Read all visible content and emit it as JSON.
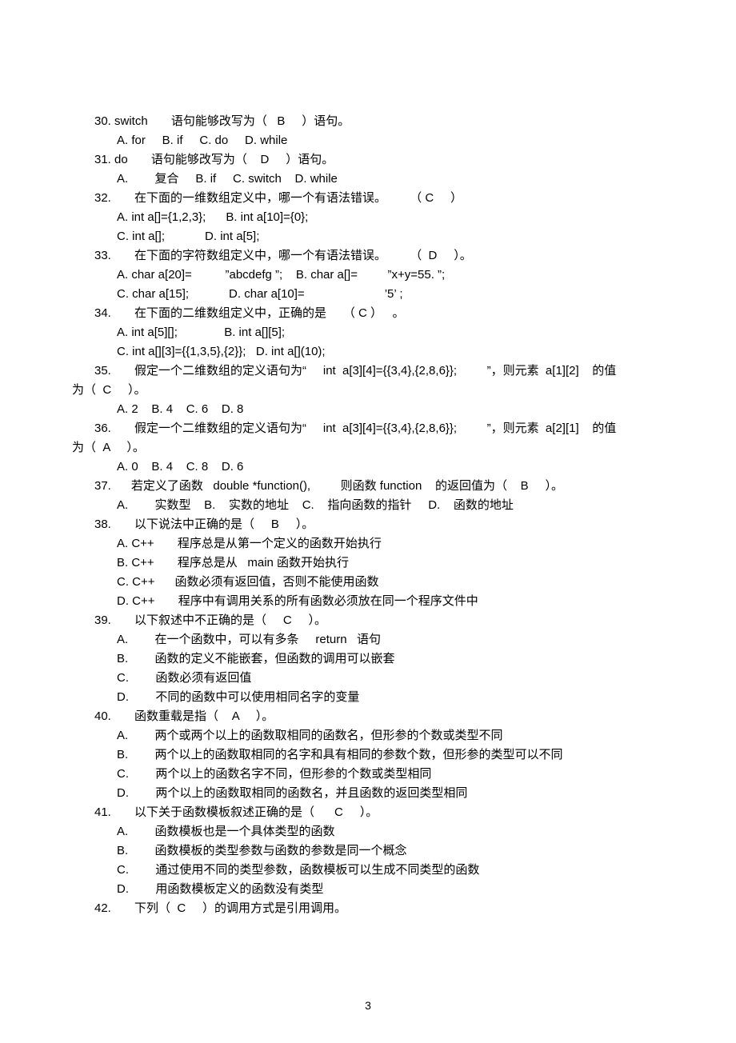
{
  "page_number": "3",
  "lines": [
    {
      "cls": "indent1",
      "text": "30. switch       语句能够改写为（   B     ）语句。"
    },
    {
      "cls": "indent2",
      "text": "A. for     B. if     C. do     D. while"
    },
    {
      "cls": "indent1",
      "text": "31. do       语句能够改写为（    D     ）语句。"
    },
    {
      "cls": "indent2",
      "text": "A.        复合     B. if     C. switch    D. while"
    },
    {
      "cls": "indent1",
      "text": "32.       在下面的一维数组定义中，哪一个有语法错误。       （ C     ）"
    },
    {
      "cls": "indent2",
      "text": "A. int a[]={1,2,3};      B. int a[10]={0};"
    },
    {
      "cls": "indent2",
      "text": "C. int a[];            D. int a[5];"
    },
    {
      "cls": "indent1",
      "text": "33.       在下面的字符数组定义中，哪一个有语法错误。       （  D     ）。"
    },
    {
      "cls": "indent2",
      "text": "A. char a[20]=          ”abcdefg ”;    B. char a[]=         ”x+y=55. ”;"
    },
    {
      "cls": "indent2",
      "text": "C. char a[15];            D. char a[10]=                        ’5’ ;"
    },
    {
      "cls": "indent1",
      "text": "34.       在下面的二维数组定义中，正确的是     （ C ）   。"
    },
    {
      "cls": "indent2",
      "text": "A. int a[5][];              B. int a[][5];"
    },
    {
      "cls": "indent2",
      "text": "C. int a[][3]={{1,3,5},{2}};   D. int a[](10);"
    },
    {
      "cls": "indent1",
      "text": "35.       假定一个二维数组的定义语句为“     int  a[3][4]={{3,4},{2,8,6}};         ”，则元素  a[1][2]    的值"
    },
    {
      "cls": "wrapline",
      "text": "为（  C     ）。"
    },
    {
      "cls": "indent2",
      "text": "A. 2    B. 4    C. 6    D. 8"
    },
    {
      "cls": "indent1",
      "text": "36.       假定一个二维数组的定义语句为“     int  a[3][4]={{3,4},{2,8,6}};         ”，则元素  a[2][1]    的值"
    },
    {
      "cls": "wrapline",
      "text": "为（  A     ）。"
    },
    {
      "cls": "indent2",
      "text": "A. 0    B. 4    C. 8    D. 6"
    },
    {
      "cls": "indent1",
      "text": "37.      若定义了函数   double *function(),         则函数 function    的返回值为（    B     ）。"
    },
    {
      "cls": "indent2",
      "text": "A.        实数型    B.    实数的地址    C.    指向函数的指针     D.    函数的地址"
    },
    {
      "cls": "indent1",
      "text": "38.       以下说法中正确的是（     B     ）。"
    },
    {
      "cls": "indent2",
      "text": "A. C++       程序总是从第一个定义的函数开始执行"
    },
    {
      "cls": "indent2",
      "text": "B. C++       程序总是从   main 函数开始执行"
    },
    {
      "cls": "indent2",
      "text": "C. C++      函数必须有返回值，否则不能使用函数"
    },
    {
      "cls": "indent2",
      "text": "D. C++       程序中有调用关系的所有函数必须放在同一个程序文件中"
    },
    {
      "cls": "indent1",
      "text": "39.       以下叙述中不正确的是（     C     ）。"
    },
    {
      "cls": "indent2",
      "text": "A.        在一个函数中，可以有多条     return   语句"
    },
    {
      "cls": "indent2",
      "text": "B.        函数的定义不能嵌套，但函数的调用可以嵌套"
    },
    {
      "cls": "indent2",
      "text": "C.        函数必须有返回值"
    },
    {
      "cls": "indent2",
      "text": "D.        不同的函数中可以使用相同名字的变量"
    },
    {
      "cls": "indent1",
      "text": "40.       函数重载是指（    A     ）。"
    },
    {
      "cls": "indent2",
      "text": "A.        两个或两个以上的函数取相同的函数名，但形参的个数或类型不同"
    },
    {
      "cls": "indent2",
      "text": "B.        两个以上的函数取相同的名字和具有相同的参数个数，但形参的类型可以不同"
    },
    {
      "cls": "indent2",
      "text": "C.        两个以上的函数名字不同，但形参的个数或类型相同"
    },
    {
      "cls": "indent2",
      "text": "D.        两个以上的函数取相同的函数名，并且函数的返回类型相同"
    },
    {
      "cls": "indent1",
      "text": "41.       以下关于函数模板叙述正确的是（      C     ）。"
    },
    {
      "cls": "indent2",
      "text": "A.        函数模板也是一个具体类型的函数"
    },
    {
      "cls": "indent2",
      "text": "B.        函数模板的类型参数与函数的参数是同一个概念"
    },
    {
      "cls": "indent2",
      "text": "C.        通过使用不同的类型参数，函数模板可以生成不同类型的函数"
    },
    {
      "cls": "indent2",
      "text": "D.        用函数模板定义的函数没有类型"
    },
    {
      "cls": "indent1",
      "text": "42.       下列（  C     ）的调用方式是引用调用。"
    }
  ]
}
